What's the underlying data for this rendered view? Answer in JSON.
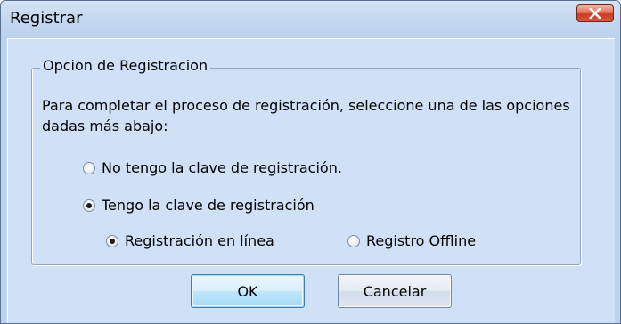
{
  "window": {
    "title": "Registrar"
  },
  "group": {
    "legend": "Opcion de Registracion",
    "description": "Para completar el proceso de registración, seleccione una de las opciones dadas más abajo:"
  },
  "options": {
    "no_key": {
      "label": "No tengo la clave de registración.",
      "checked": false
    },
    "have_key": {
      "label": "Tengo la clave de registración",
      "checked": true
    },
    "online": {
      "label": "Registración en línea",
      "checked": true
    },
    "offline": {
      "label": "Registro Offline",
      "checked": false
    }
  },
  "buttons": {
    "ok": "OK",
    "cancel": "Cancelar"
  }
}
